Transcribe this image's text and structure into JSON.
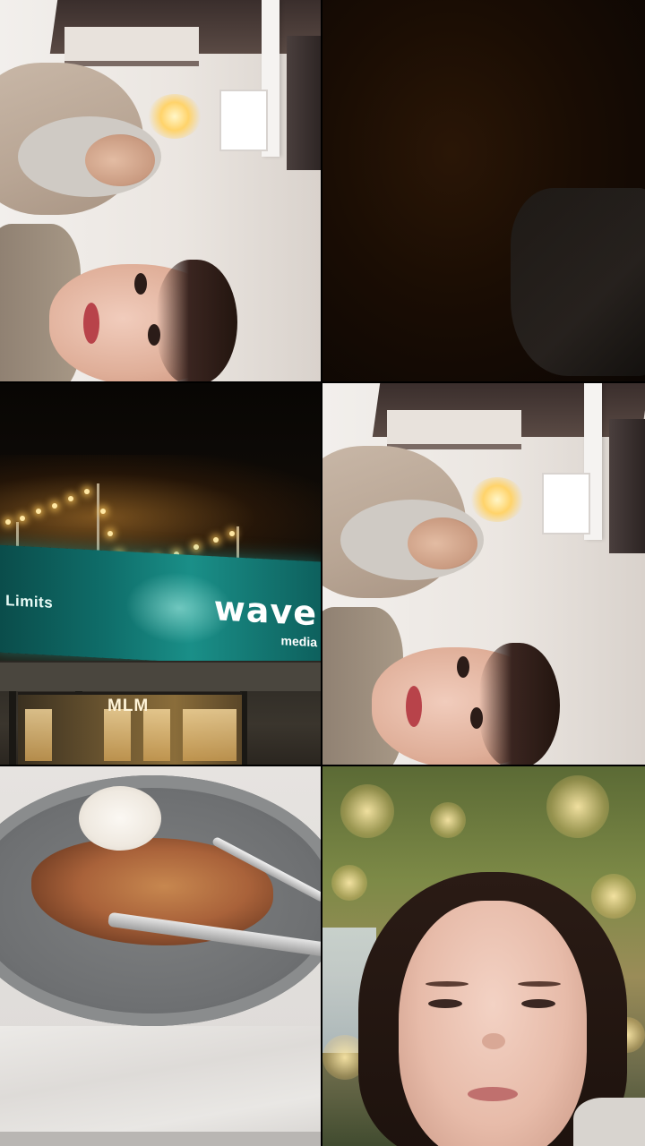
{
  "collage": {
    "tiles": [
      {
        "id": "tile-1",
        "scene": "rotated-selfie-restaurant"
      },
      {
        "id": "tile-2",
        "scene": "dark-blurry"
      },
      {
        "id": "tile-3",
        "scene": "night-street-billboard"
      },
      {
        "id": "tile-4",
        "scene": "rotated-selfie-restaurant"
      },
      {
        "id": "tile-5",
        "scene": "food-plate"
      },
      {
        "id": "tile-6",
        "scene": "selfie-trees-lights"
      }
    ]
  },
  "billboard": {
    "left_text": "d Limits",
    "brand": "wave",
    "brand_sub": "media"
  },
  "storefront": {
    "sign": "MLM"
  },
  "colors": {
    "billboard_teal": "#0f6e6a",
    "string_lights": "#ffe7a3",
    "plate_gray": "#6e7072"
  }
}
